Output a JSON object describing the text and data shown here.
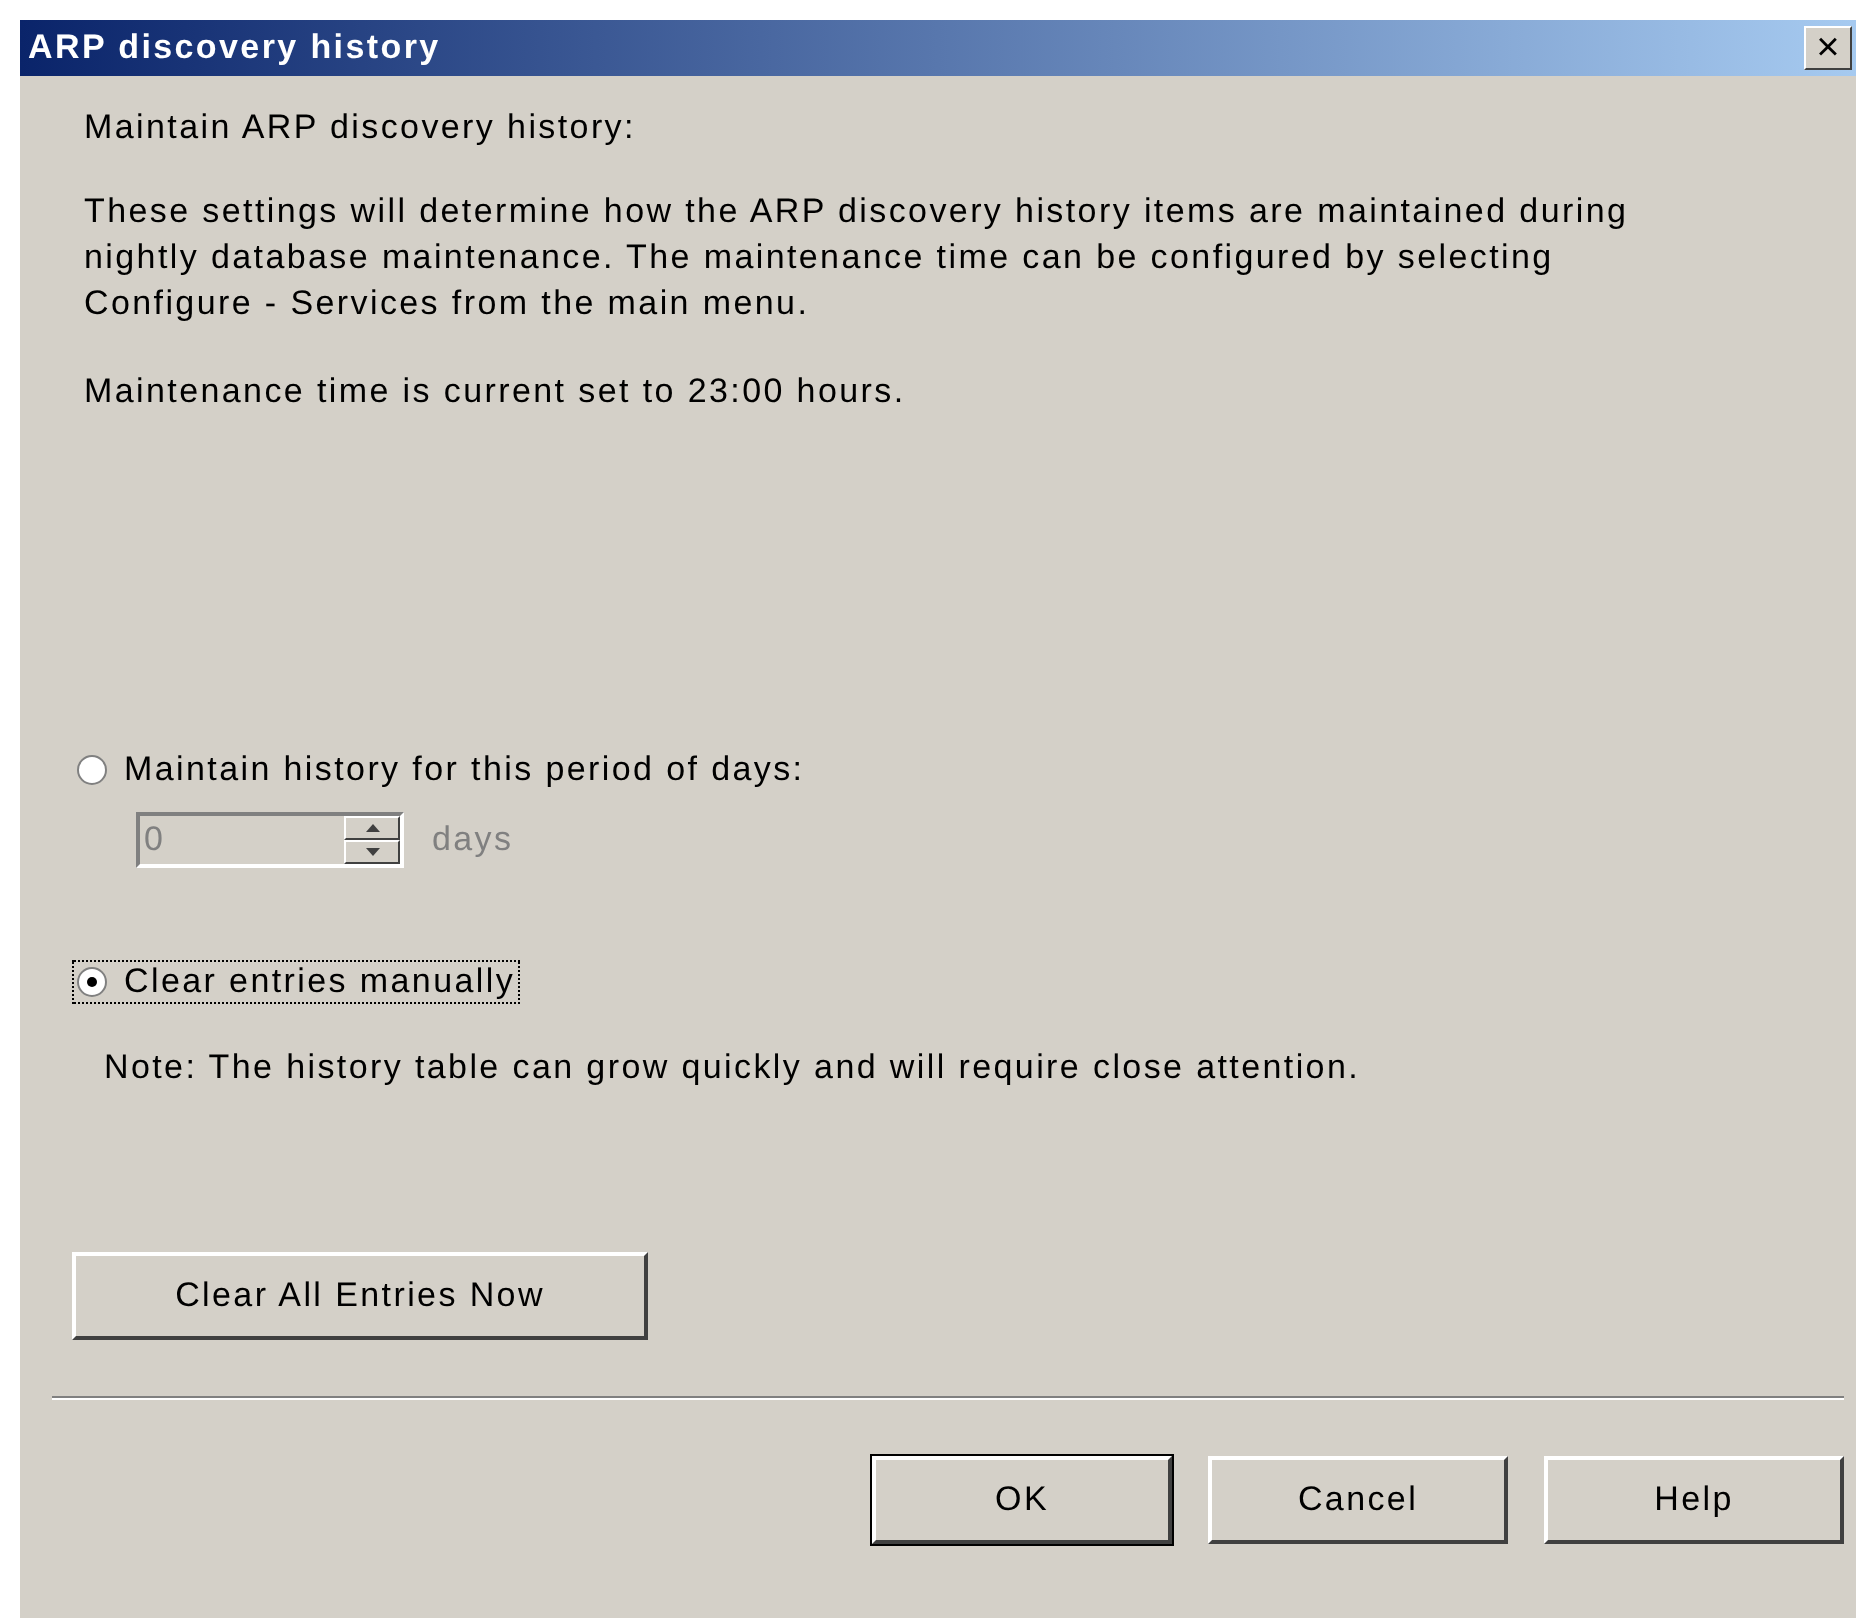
{
  "window": {
    "title": "ARP discovery history",
    "close": "×"
  },
  "heading": "Maintain ARP discovery history:",
  "description": "These settings will determine how the ARP discovery history items are maintained during nightly database maintenance. The maintenance time can be configured by selecting Configure - Services from the main menu.",
  "maintenance_time": "Maintenance time is current set to 23:00 hours.",
  "options": [
    {
      "label": "Maintain history for this period of days:",
      "selected": false,
      "focused": false
    },
    {
      "label": "Clear entries manually",
      "selected": true,
      "focused": true
    }
  ],
  "days_field": {
    "value": "0",
    "unit": "days",
    "disabled": true
  },
  "note": "Note: The history table can grow quickly and will require close attention.",
  "clear_button": "Clear All Entries Now",
  "buttons": [
    {
      "label": "OK",
      "default": true
    },
    {
      "label": "Cancel",
      "default": false
    },
    {
      "label": "Help",
      "default": false
    }
  ]
}
